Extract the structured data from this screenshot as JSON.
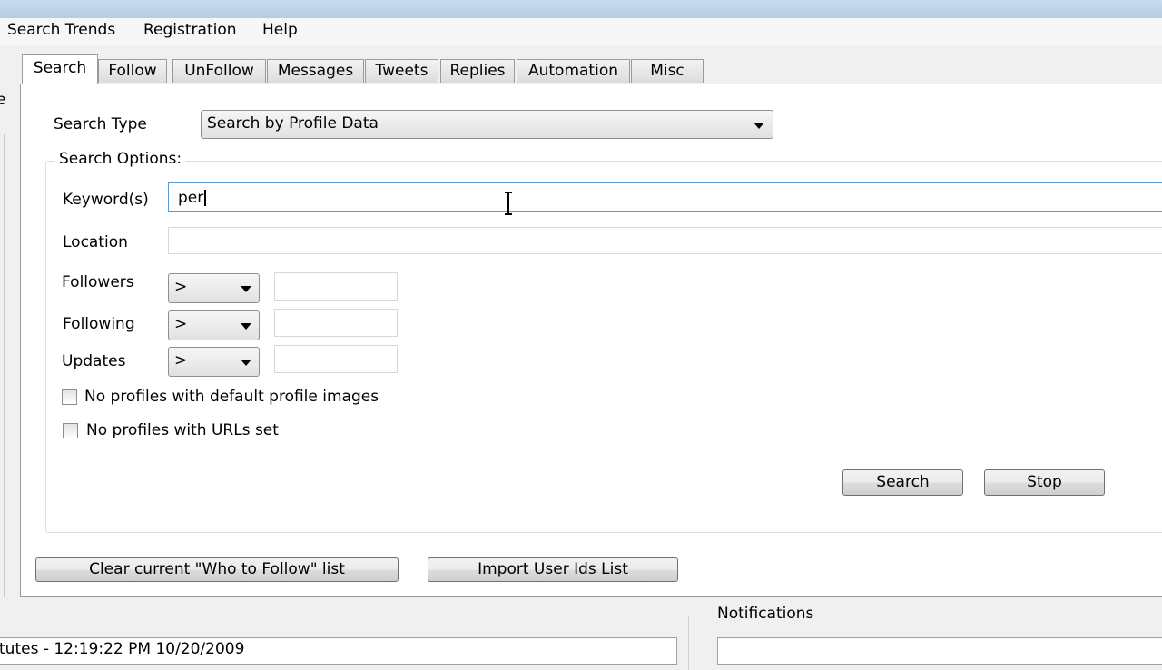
{
  "menu": {
    "items": [
      "Search Trends",
      "Registration",
      "Help"
    ]
  },
  "left_cut_text": "e",
  "tabs": [
    {
      "label": "Search",
      "active": true
    },
    {
      "label": "Follow",
      "active": false
    },
    {
      "label": "UnFollow",
      "active": false
    },
    {
      "label": "Messages",
      "active": false
    },
    {
      "label": "Tweets",
      "active": false
    },
    {
      "label": "Replies",
      "active": false
    },
    {
      "label": "Automation",
      "active": false
    },
    {
      "label": "Misc",
      "active": false
    }
  ],
  "search": {
    "type_label": "Search Type",
    "type_value": "Search by Profile Data",
    "options_label": "Search Options:",
    "keywords_label": "Keyword(s)",
    "keywords_value": "per",
    "location_label": "Location",
    "location_value": "",
    "followers_label": "Followers",
    "followers_op": ">",
    "followers_value": "",
    "following_label": "Following",
    "following_op": ">",
    "following_value": "",
    "updates_label": "Updates",
    "updates_op": ">",
    "updates_value": "",
    "no_default_images_label": "No profiles with default profile images",
    "no_default_images_checked": false,
    "no_urls_label": "No profiles with URLs set",
    "no_urls_checked": false,
    "search_button": "Search",
    "stop_button": "Stop"
  },
  "actions": {
    "clear_label": "Clear current \"Who to Follow\" list",
    "import_label": "Import User Ids List"
  },
  "notifications": {
    "title": "Notifications"
  },
  "status": {
    "text": "tutes - 12:19:22 PM 10/20/2009"
  }
}
